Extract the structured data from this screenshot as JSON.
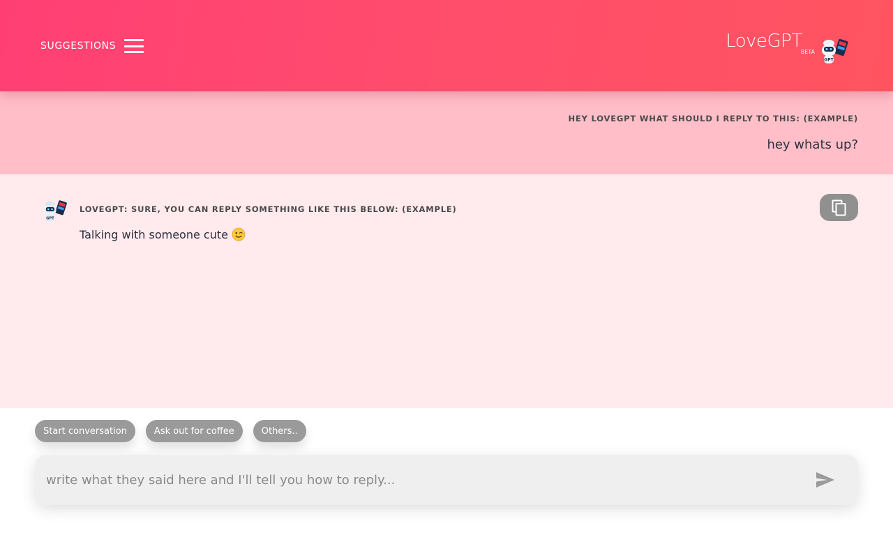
{
  "header": {
    "suggestions_label": "SUGGESTIONS",
    "brand_name": "LoveGPT",
    "brand_badge": "BETA",
    "robot_badge": "GPT"
  },
  "user_message": {
    "label": "HEY LOVEGPT WHAT SHOULD I REPLY TO THIS: (EXAMPLE)",
    "text": "hey whats up?"
  },
  "bot_message": {
    "label": "LOVEGPT: SURE, YOU CAN REPLY SOMETHING LIKE THIS BELOW: (EXAMPLE)",
    "text": "Talking with someone cute",
    "emoji": "wink-emoji"
  },
  "chips": [
    {
      "label": "Start conversation"
    },
    {
      "label": "Ask out for coffee"
    },
    {
      "label": "Others.."
    }
  ],
  "input": {
    "placeholder": "write what they said here and I'll tell you how to reply...",
    "value": ""
  },
  "colors": {
    "header_start": "#ff3f74",
    "header_end": "#ff5460",
    "user_band": "#ffbec8",
    "bot_band": "#ffeaed",
    "chip": "#9a9a9a",
    "copy_button": "#909090"
  },
  "icons": {
    "menu": "hamburger-menu-icon",
    "copy": "copy-icon",
    "send": "send-icon",
    "robot": "robot-avatar-icon"
  }
}
